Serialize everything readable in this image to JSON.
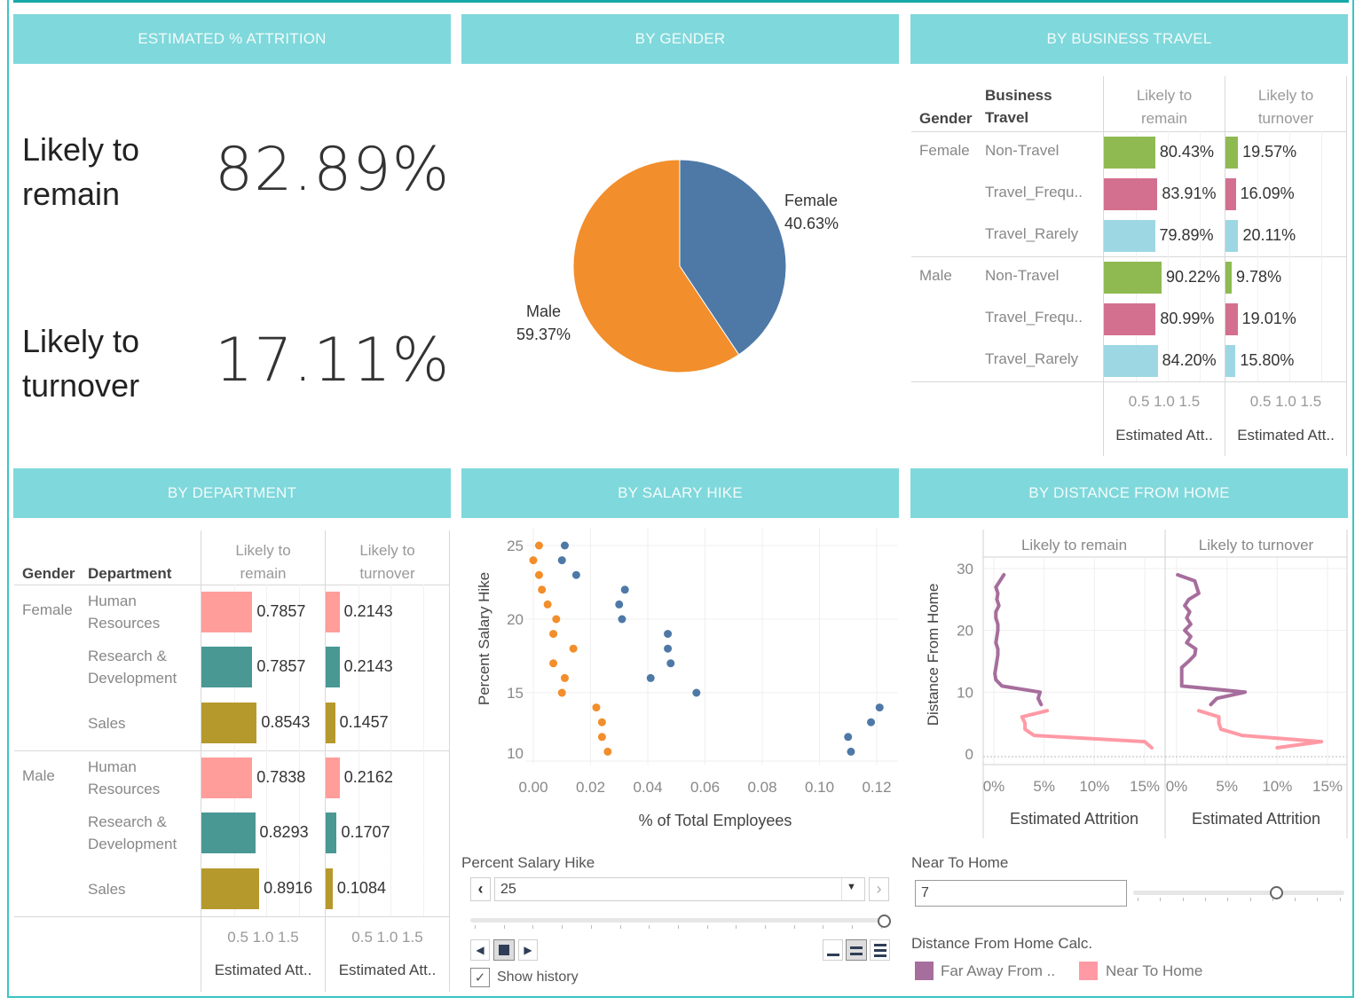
{
  "colors": {
    "header_bg": "#7fd8db",
    "frame": "#3cc4c4",
    "female": "#4e79a7",
    "male": "#f28e2b",
    "non_travel": "#8fba52",
    "travel_frequently": "#d4708f",
    "travel_rarely": "#9ed7e4",
    "human_resources": "#ff9d9a",
    "rnd": "#499894",
    "sales": "#b6992d",
    "far_away": "#a66e9c",
    "near_home": "#ff9aa5"
  },
  "panels": {
    "attrition": {
      "title": "ESTIMATED % ATTRITION"
    },
    "gender": {
      "title": "BY GENDER"
    },
    "business_travel": {
      "title": "BY BUSINESS TRAVEL"
    },
    "department": {
      "title": "BY DEPARTMENT"
    },
    "salary_hike": {
      "title": "BY SALARY HIKE"
    },
    "distance": {
      "title": "BY DISTANCE FROM HOME"
    }
  },
  "kpis": {
    "remain": {
      "label_line1": "Likely to",
      "label_line2": "remain",
      "value": "82.89%"
    },
    "turnover": {
      "label_line1": "Likely to",
      "label_line2": "turnover",
      "value": "17.11%"
    }
  },
  "chart_data": [
    {
      "id": "gender_pie",
      "type": "pie",
      "title": "BY GENDER",
      "slices": [
        {
          "label": "Female",
          "value": 40.63,
          "display": "40.63%",
          "color": "#4e79a7"
        },
        {
          "label": "Male",
          "value": 59.37,
          "display": "59.37%",
          "color": "#f28e2b"
        }
      ]
    },
    {
      "id": "business_travel",
      "type": "bar",
      "title": "BY BUSINESS TRAVEL",
      "row_headers": [
        "Gender",
        "Business Travel"
      ],
      "row_header_line1": "Business",
      "row_header_line2": "Travel",
      "columns": [
        {
          "line1": "Likely to",
          "line2": "remain"
        },
        {
          "line1": "Likely to",
          "line2": "turnover"
        }
      ],
      "xticks": [
        "0.5",
        "1.0",
        "1.5"
      ],
      "xlabel": "Estimated Att..",
      "xlim": [
        0,
        1.8
      ],
      "rows": [
        {
          "gender": "Female",
          "category": "Non-Travel",
          "remain": 0.8043,
          "turnover": 0.1957,
          "remain_label": "80.43%",
          "turnover_label": "19.57%",
          "color": "#8fba52"
        },
        {
          "gender": "",
          "category": "Travel_Frequ..",
          "remain": 0.8391,
          "turnover": 0.1609,
          "remain_label": "83.91%",
          "turnover_label": "16.09%",
          "color": "#d4708f"
        },
        {
          "gender": "",
          "category": "Travel_Rarely",
          "remain": 0.7989,
          "turnover": 0.2011,
          "remain_label": "79.89%",
          "turnover_label": "20.11%",
          "color": "#9ed7e4"
        },
        {
          "gender": "Male",
          "category": "Non-Travel",
          "remain": 0.9022,
          "turnover": 0.0978,
          "remain_label": "90.22%",
          "turnover_label": "9.78%",
          "color": "#8fba52"
        },
        {
          "gender": "",
          "category": "Travel_Frequ..",
          "remain": 0.8099,
          "turnover": 0.1901,
          "remain_label": "80.99%",
          "turnover_label": "19.01%",
          "color": "#d4708f"
        },
        {
          "gender": "",
          "category": "Travel_Rarely",
          "remain": 0.842,
          "turnover": 0.158,
          "remain_label": "84.20%",
          "turnover_label": "15.80%",
          "color": "#9ed7e4"
        }
      ]
    },
    {
      "id": "department",
      "type": "bar",
      "title": "BY DEPARTMENT",
      "row_headers": [
        "Gender",
        "Department"
      ],
      "columns": [
        {
          "line1": "Likely to",
          "line2": "remain"
        },
        {
          "line1": "Likely to",
          "line2": "turnover"
        }
      ],
      "xticks": [
        "0.5",
        "1.0",
        "1.5"
      ],
      "xlabel": "Estimated Att..",
      "xlim": [
        0,
        1.8
      ],
      "rows": [
        {
          "gender": "Female",
          "line1": "Human",
          "line2": "Resources",
          "remain": 0.7857,
          "turnover": 0.2143,
          "remain_label": "0.7857",
          "turnover_label": "0.2143",
          "color": "#ff9d9a"
        },
        {
          "gender": "",
          "line1": "Research &",
          "line2": "Development",
          "remain": 0.7857,
          "turnover": 0.2143,
          "remain_label": "0.7857",
          "turnover_label": "0.2143",
          "color": "#499894"
        },
        {
          "gender": "",
          "line1": "Sales",
          "line2": "",
          "remain": 0.8543,
          "turnover": 0.1457,
          "remain_label": "0.8543",
          "turnover_label": "0.1457",
          "color": "#b6992d"
        },
        {
          "gender": "Male",
          "line1": "Human",
          "line2": "Resources",
          "remain": 0.7838,
          "turnover": 0.2162,
          "remain_label": "0.7838",
          "turnover_label": "0.2162",
          "color": "#ff9d9a"
        },
        {
          "gender": "",
          "line1": "Research &",
          "line2": "Development",
          "remain": 0.8293,
          "turnover": 0.1707,
          "remain_label": "0.8293",
          "turnover_label": "0.1707",
          "color": "#499894"
        },
        {
          "gender": "",
          "line1": "Sales",
          "line2": "",
          "remain": 0.8916,
          "turnover": 0.1084,
          "remain_label": "0.8916",
          "turnover_label": "0.1084",
          "color": "#b6992d"
        }
      ]
    },
    {
      "id": "salary_hike",
      "type": "scatter",
      "title": "BY SALARY HIKE",
      "xlabel": "% of Total Employees",
      "ylabel": "Percent Salary Hike",
      "xlim": [
        0,
        0.12
      ],
      "ylim": [
        11,
        25
      ],
      "xticks": [
        "0.00",
        "0.02",
        "0.04",
        "0.06",
        "0.08",
        "0.10",
        "0.12"
      ],
      "yticks": [
        "25",
        "20",
        "15",
        "10"
      ],
      "grid": true,
      "series": [
        {
          "name": "Male",
          "color": "#f28e2b",
          "points": [
            [
              0.002,
              25
            ],
            [
              0.0,
              24
            ],
            [
              0.002,
              23
            ],
            [
              0.003,
              22
            ],
            [
              0.005,
              21
            ],
            [
              0.008,
              20
            ],
            [
              0.007,
              19
            ],
            [
              0.014,
              18
            ],
            [
              0.007,
              17
            ],
            [
              0.011,
              16
            ],
            [
              0.01,
              15
            ],
            [
              0.022,
              14
            ],
            [
              0.024,
              13
            ],
            [
              0.024,
              12
            ],
            [
              0.026,
              11
            ]
          ]
        },
        {
          "name": "Female",
          "color": "#4e79a7",
          "points": [
            [
              0.011,
              25
            ],
            [
              0.01,
              24
            ],
            [
              0.015,
              23
            ],
            [
              0.032,
              22
            ],
            [
              0.03,
              21
            ],
            [
              0.031,
              20
            ],
            [
              0.047,
              19
            ],
            [
              0.047,
              18
            ],
            [
              0.048,
              17
            ],
            [
              0.041,
              16
            ],
            [
              0.057,
              15
            ],
            [
              0.121,
              14
            ],
            [
              0.118,
              13
            ],
            [
              0.11,
              12
            ],
            [
              0.111,
              11
            ]
          ]
        }
      ]
    },
    {
      "id": "distance_from_home",
      "type": "line",
      "title": "BY DISTANCE FROM HOME",
      "panels": [
        "Likely to remain",
        "Likely to turnover"
      ],
      "xlabel": "Estimated Attrition",
      "ylabel": "Distance From Home",
      "xlim": [
        0,
        0.16
      ],
      "ylim": [
        0,
        30
      ],
      "xticks": [
        "0%",
        "5%",
        "10%",
        "15%"
      ],
      "yticks": [
        "30",
        "20",
        "10",
        "0"
      ],
      "series": [
        {
          "name": "Far Away From ..",
          "panel": 0,
          "color": "#a66e9c",
          "points": [
            [
              0.01,
              29
            ],
            [
              0.002,
              27
            ],
            [
              0.004,
              26
            ],
            [
              0.003,
              25
            ],
            [
              0.005,
              24
            ],
            [
              0.002,
              23
            ],
            [
              0.002,
              22
            ],
            [
              0.004,
              21
            ],
            [
              0.004,
              20
            ],
            [
              0.003,
              19
            ],
            [
              0.002,
              18
            ],
            [
              0.004,
              17
            ],
            [
              0.004,
              16
            ],
            [
              0.003,
              15
            ],
            [
              0.002,
              14
            ],
            [
              0.001,
              13
            ],
            [
              0.002,
              12
            ],
            [
              0.008,
              11
            ],
            [
              0.046,
              10
            ],
            [
              0.044,
              9
            ],
            [
              0.047,
              8
            ]
          ]
        },
        {
          "name": "Near To Home",
          "panel": 0,
          "color": "#ff9aa5",
          "points": [
            [
              0.053,
              7
            ],
            [
              0.028,
              6
            ],
            [
              0.031,
              5
            ],
            [
              0.031,
              4
            ],
            [
              0.04,
              3
            ],
            [
              0.15,
              2
            ],
            [
              0.157,
              1
            ]
          ]
        },
        {
          "name": "Far Away From ..",
          "panel": 1,
          "color": "#a66e9c",
          "points": [
            [
              0.001,
              29
            ],
            [
              0.018,
              28
            ],
            [
              0.022,
              26
            ],
            [
              0.012,
              25
            ],
            [
              0.008,
              24
            ],
            [
              0.013,
              23
            ],
            [
              0.01,
              22
            ],
            [
              0.014,
              21
            ],
            [
              0.008,
              20
            ],
            [
              0.014,
              19
            ],
            [
              0.01,
              18
            ],
            [
              0.019,
              17
            ],
            [
              0.018,
              16
            ],
            [
              0.012,
              15
            ],
            [
              0.005,
              14
            ],
            [
              0.005,
              13
            ],
            [
              0.005,
              12
            ],
            [
              0.005,
              11
            ],
            [
              0.068,
              10
            ],
            [
              0.04,
              9
            ],
            [
              0.034,
              8
            ]
          ]
        },
        {
          "name": "Near To Home",
          "panel": 1,
          "color": "#ff9aa5",
          "points": [
            [
              0.022,
              7
            ],
            [
              0.042,
              6
            ],
            [
              0.042,
              5
            ],
            [
              0.044,
              4
            ],
            [
              0.065,
              3
            ],
            [
              0.144,
              2
            ],
            [
              0.1,
              1
            ]
          ]
        }
      ]
    }
  ],
  "controls": {
    "salary_filter": {
      "label": "Percent Salary Hike",
      "value": "25",
      "prev_icon": "chevron-left",
      "next_icon": "chevron-right",
      "slider_fraction": 1.0,
      "show_history_label": "Show history",
      "show_history_checked": true
    },
    "near_home": {
      "label": "Near To Home",
      "value": "7",
      "slider_fraction": 0.66
    },
    "legend": {
      "title": "Distance From Home Calc.",
      "items": [
        {
          "label": "Far Away From ..",
          "color": "#a66e9c"
        },
        {
          "label": "Near To Home",
          "color": "#ff9aa5"
        }
      ]
    }
  }
}
